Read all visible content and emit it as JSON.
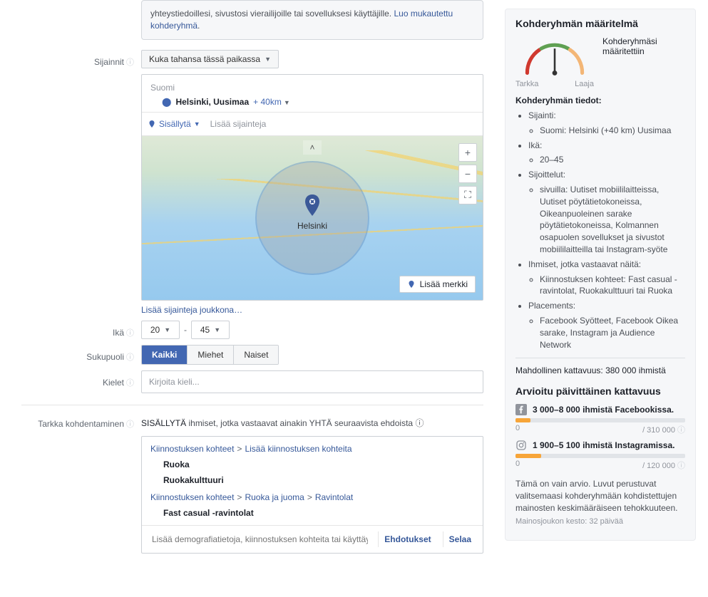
{
  "info": {
    "text_partial": "yhteystiedoillesi, sivustosi vierailijoille tai sovelluksesi käyttäjille. ",
    "link": "Luo mukautettu kohderyhmä"
  },
  "locations": {
    "label": "Sijainnit",
    "mode": "Kuka tahansa tässä paikassa",
    "country": "Suomi",
    "item_name": "Helsinki, Uusimaa",
    "item_radius": "+ 40km",
    "include_label": "Sisällytä",
    "add_locations_placeholder": "Lisää sijainteja",
    "map_label": "Helsinki",
    "add_pin": "Lisää merkki",
    "bulk_link": "Lisää sijainteja joukkona…"
  },
  "age": {
    "label": "Ikä",
    "min": "20",
    "max": "45"
  },
  "gender": {
    "label": "Sukupuoli",
    "all": "Kaikki",
    "men": "Miehet",
    "women": "Naiset"
  },
  "languages": {
    "label": "Kielet",
    "placeholder": "Kirjoita kieli..."
  },
  "detailed": {
    "label": "Tarkka kohdentaminen",
    "header_prefix": "SISÄLLYTÄ",
    "header_rest": " ihmiset, jotka vastaavat ainakin YHTÄ seuraavista ehdoista",
    "path1_a": "Kiinnostuksen kohteet",
    "path1_b": "Lisää kiinnostuksen kohteita",
    "item1": "Ruoka",
    "item2": "Ruokakulttuuri",
    "path2_a": "Kiinnostuksen kohteet",
    "path2_b": "Ruoka ja juoma",
    "path2_c": "Ravintolat",
    "item3": "Fast casual -ravintolat",
    "footer_placeholder": "Lisää demografiatietoja, kiinnostuksen kohteita tai käyttäy...",
    "suggestions": "Ehdotukset",
    "browse": "Selaa"
  },
  "right": {
    "title": "Kohderyhmän määritelmä",
    "gauge_left": "Tarkka",
    "gauge_right": "Laaja",
    "gauge_status": "Kohderyhmäsi määritettiin",
    "details_title": "Kohderyhmän tiedot:",
    "loc_label": "Sijainti:",
    "loc_value": "Suomi: Helsinki (+40 km) Uusimaa",
    "age_label": "Ikä:",
    "age_value": "20–45",
    "placement_label": "Sijoittelut:",
    "placement_value": "sivuilla: Uutiset mobiililaitteissa, Uutiset pöytätietokoneissa, Oikeanpuoleinen sarake pöytätietokoneissa, Kolmannen osapuolen sovellukset ja sivustot mobiililaitteilla tai Instagram-syöte",
    "match_label": "Ihmiset, jotka vastaavat näitä:",
    "match_value": "Kiinnostuksen kohteet: Fast casual -ravintolat, Ruokakulttuuri tai Ruoka",
    "placements2_label": "Placements:",
    "placements2_value": "Facebook Syötteet, Facebook Oikea sarake, Instagram ja Audience Network",
    "potential_label": "Mahdollinen kattavuus: ",
    "potential_value": "380 000 ihmistä",
    "daily_title": "Arvioitu päivittäinen kattavuus",
    "fb_text": "3 000–8 000 ihmistä Facebookissa.",
    "fb_zero": "0",
    "fb_max": "/ 310 000",
    "ig_text": "1 900–5 100 ihmistä Instagramissa.",
    "ig_zero": "0",
    "ig_max": "/ 120 000",
    "note": "Tämä on vain arvio. Luvut perustuvat valitsemaasi kohderyhmään kohdistettujen mainosten keskimääräiseen tehokkuuteen.",
    "subnote": "Mainosjoukon kesto: 32 päivää"
  }
}
